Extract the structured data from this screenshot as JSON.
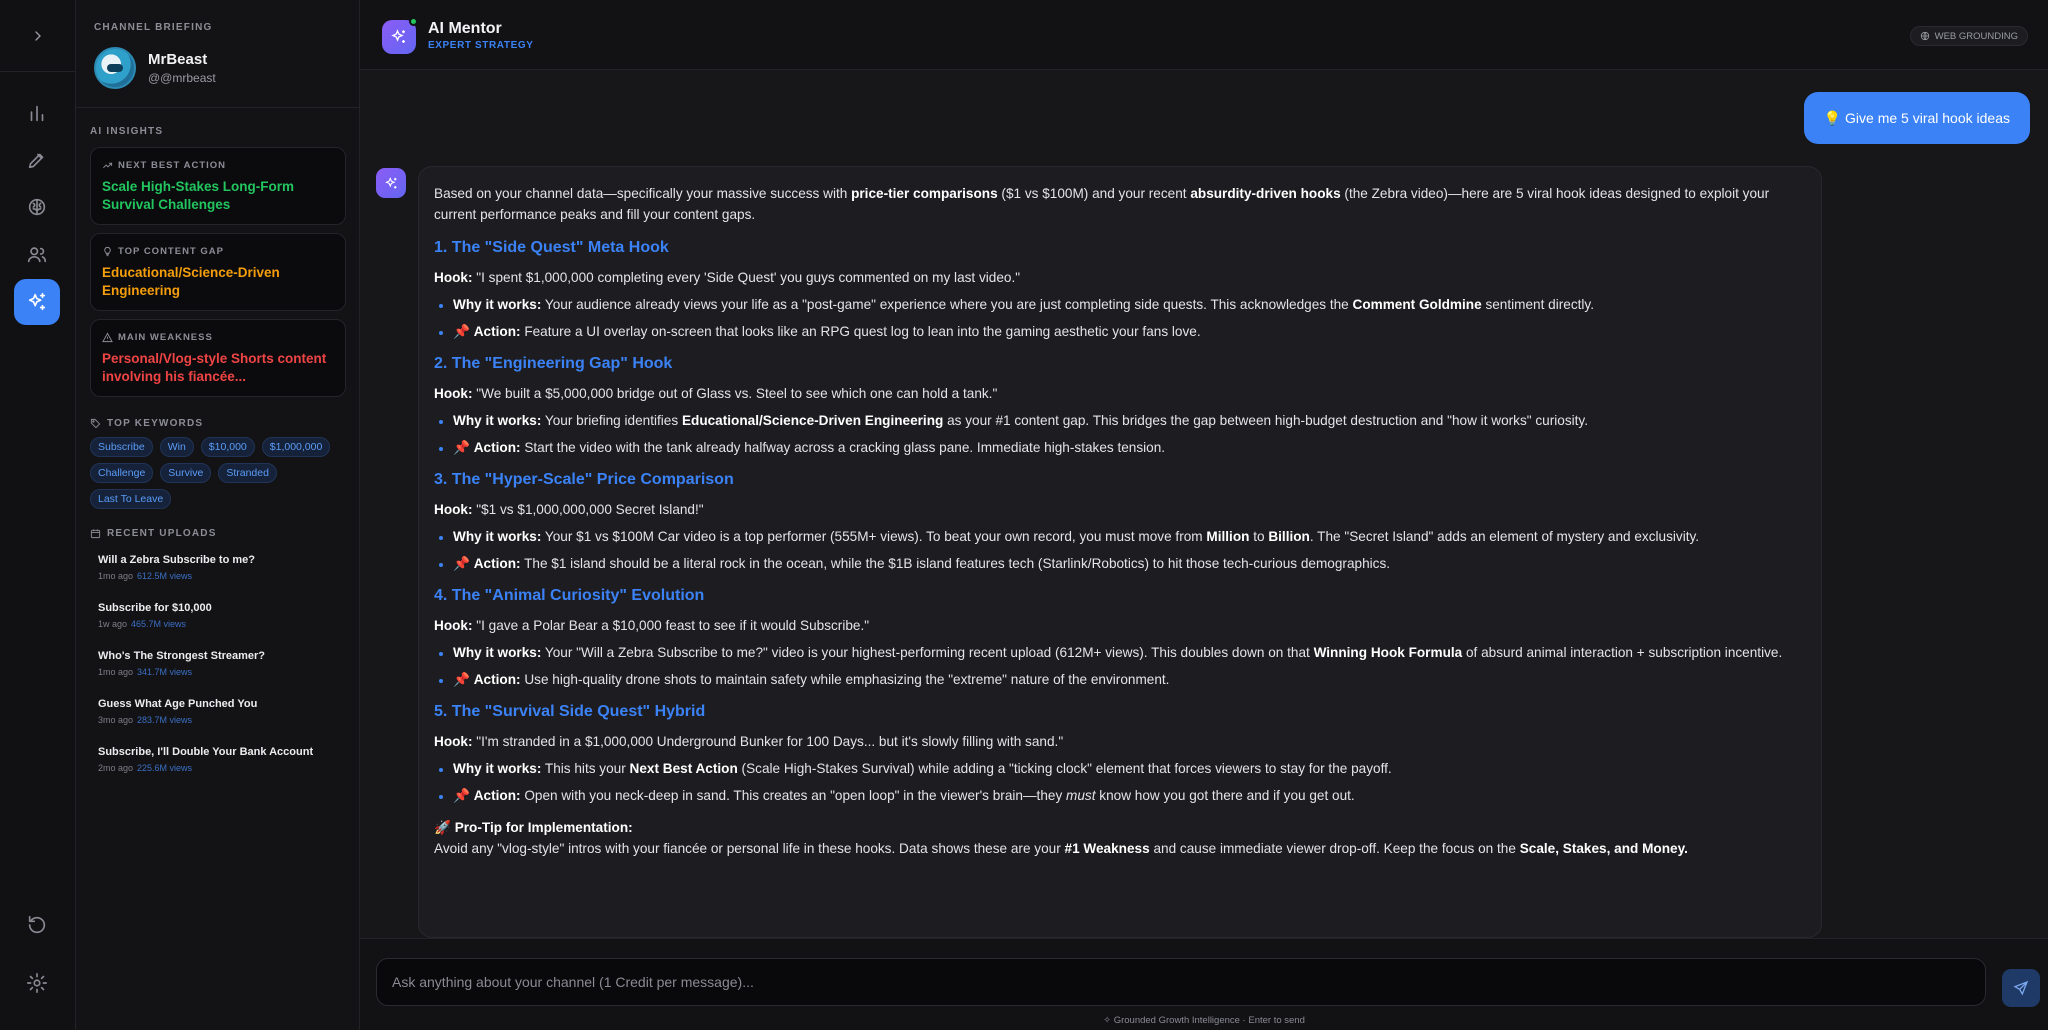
{
  "rail": {
    "toggle_icon": "chevron-right-icon",
    "items": [
      "analytics-icon",
      "pen-tool-icon",
      "brain-icon",
      "users-icon",
      "sparkles-icon"
    ],
    "bottom": [
      "refresh-icon",
      "gear-icon"
    ]
  },
  "briefing": {
    "caption": "CHANNEL BRIEFING",
    "channel_name": "MrBeast",
    "channel_handle": "@@mrbeast",
    "ai_insights_label": "AI INSIGHTS",
    "insights": [
      {
        "label": "NEXT BEST ACTION",
        "value": "Scale High-Stakes Long-Form Survival Challenges",
        "color": "#22c55e"
      },
      {
        "label": "TOP CONTENT GAP",
        "value": "Educational/Science-Driven Engineering",
        "color": "#f59e0b"
      },
      {
        "label": "MAIN WEAKNESS",
        "value": "Personal/Vlog-style Shorts content involving his fiancée...",
        "color": "#ef4444"
      }
    ],
    "keywords_label": "TOP KEYWORDS",
    "keywords": [
      "Subscribe",
      "Win",
      "$10,000",
      "$1,000,000",
      "Challenge",
      "Survive",
      "Stranded",
      "Last To Leave"
    ],
    "uploads_label": "RECENT UPLOADS",
    "uploads": [
      {
        "title": "Will a Zebra Subscribe to me?",
        "ago": "1mo ago",
        "views": "612.5M views"
      },
      {
        "title": "Subscribe for $10,000",
        "ago": "1w ago",
        "views": "465.7M views"
      },
      {
        "title": "Who's The Strongest Streamer?",
        "ago": "1mo ago",
        "views": "341.7M views"
      },
      {
        "title": "Guess What Age Punched You",
        "ago": "3mo ago",
        "views": "283.7M views"
      },
      {
        "title": "Subscribe, I'll Double Your Bank Account",
        "ago": "2mo ago",
        "views": "225.6M views"
      }
    ]
  },
  "header": {
    "title": "AI Mentor",
    "subtitle": "EXPERT STRATEGY",
    "grounding": "WEB GROUNDING",
    "accent": "#3b82f6"
  },
  "chat": {
    "user_message": "💡 Give me 5 viral hook ideas",
    "intro": {
      "t1": "Based on your channel data—specifically your massive success with ",
      "b1": "price-tier comparisons",
      "t2": " ($1 vs $100M) and your recent ",
      "b2": "absurdity-driven hooks",
      "t3": " (the Zebra video)—here are 5 viral hook ideas designed to exploit your current performance peaks and fill your content gaps."
    },
    "hooks": [
      {
        "heading": "1. The \"Side Quest\" Meta Hook",
        "hook_label": "Hook:",
        "hook": " \"I spent $1,000,000 completing every 'Side Quest' you guys commented on my last video.\"",
        "why_label": "Why it works:",
        "why": [
          " Your audience already views your life as a \"post-game\" experience where you are just completing side quests. This acknowledges the ",
          "Comment Goldmine",
          " sentiment directly."
        ],
        "action_label": "Action:",
        "action": " Feature a UI overlay on-screen that looks like an RPG quest log to lean into the gaming aesthetic your fans love."
      },
      {
        "heading": "2. The \"Engineering Gap\" Hook",
        "hook_label": "Hook:",
        "hook": " \"We built a $5,000,000 bridge out of Glass vs. Steel to see which one can hold a tank.\"",
        "why_label": "Why it works:",
        "why": [
          " Your briefing identifies ",
          "Educational/Science-Driven Engineering",
          " as your #1 content gap. This bridges the gap between high-budget destruction and \"how it works\" curiosity."
        ],
        "action_label": "Action:",
        "action": " Start the video with the tank already halfway across a cracking glass pane. Immediate high-stakes tension."
      },
      {
        "heading": "3. The \"Hyper-Scale\" Price Comparison",
        "hook_label": "Hook:",
        "hook": " \"$1 vs $1,000,000,000 Secret Island!\"",
        "why_label": "Why it works:",
        "why": [
          " Your $1 vs $100M Car video is a top performer (555M+ views). To beat your own record, you must move from ",
          "Million",
          " to ",
          "Billion",
          ". The \"Secret Island\" adds an element of mystery and exclusivity."
        ],
        "action_label": "Action:",
        "action": " The $1 island should be a literal rock in the ocean, while the $1B island features tech (Starlink/Robotics) to hit those tech-curious demographics."
      },
      {
        "heading": "4. The \"Animal Curiosity\" Evolution",
        "hook_label": "Hook:",
        "hook": " \"I gave a Polar Bear a $10,000 feast to see if it would Subscribe.\"",
        "why_label": "Why it works:",
        "why": [
          " Your \"Will a Zebra Subscribe to me?\" video is your highest-performing recent upload (612M+ views). This doubles down on that ",
          "Winning Hook Formula",
          " of absurd animal interaction + subscription incentive."
        ],
        "action_label": "Action:",
        "action": " Use high-quality drone shots to maintain safety while emphasizing the \"extreme\" nature of the environment."
      },
      {
        "heading": "5. The \"Survival Side Quest\" Hybrid",
        "hook_label": "Hook:",
        "hook": " \"I'm stranded in a $1,000,000 Underground Bunker for 100 Days... but it's slowly filling with sand.\"",
        "why_label": "Why it works:",
        "why": [
          " This hits your ",
          "Next Best Action",
          " (Scale High-Stakes Survival) while adding a \"ticking clock\" element that forces viewers to stay for the payoff."
        ],
        "action_label": "Action:",
        "action_parts": [
          " Open with you neck-deep in sand. This creates an \"open loop\" in the viewer's brain—they ",
          "must",
          " know how you got there and if you get out."
        ]
      }
    ],
    "pro_tip_title": "🚀 Pro-Tip for Implementation:",
    "pro_tip": {
      "t1": "Avoid any \"vlog-style\" intros with your fiancée or personal life in these hooks. Data shows these are your ",
      "b1": "#1 Weakness",
      "t2": " and cause immediate viewer drop-off. Keep the focus on the ",
      "b2": "Scale, Stakes, and Money."
    },
    "input_placeholder": "Ask anything about your channel (1 Credit per message)...",
    "footnote": "✧ Grounded Growth Intelligence · Enter to send"
  }
}
